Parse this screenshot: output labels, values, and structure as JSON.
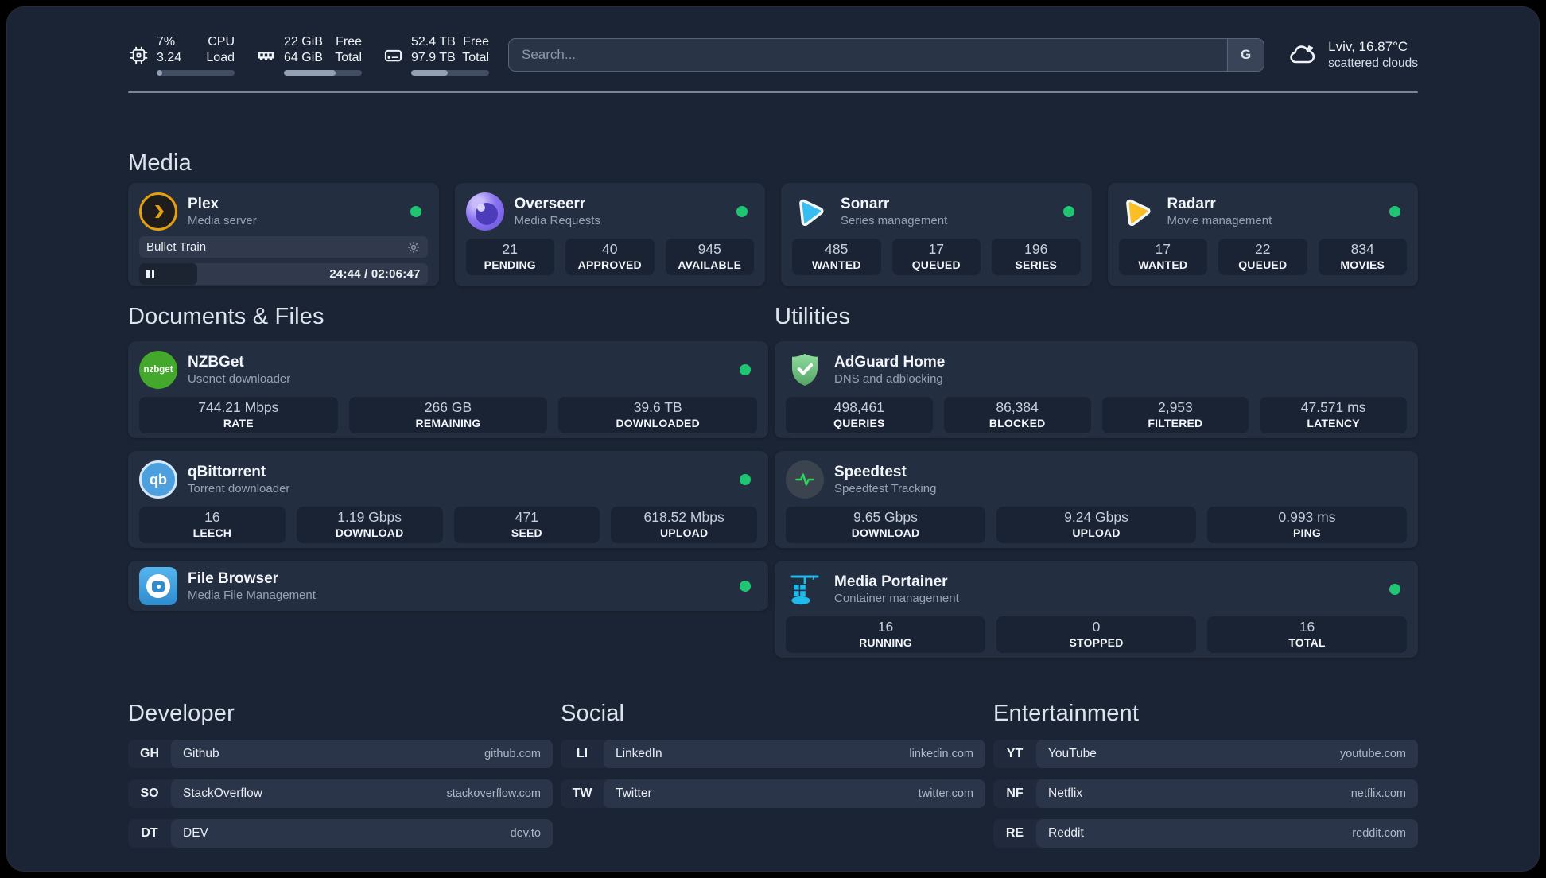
{
  "topbar": {
    "cpu": {
      "value1": "7%",
      "value2": "3.24",
      "label1": "CPU",
      "label2": "Load",
      "fill": 7
    },
    "memory": {
      "value1": "22 GiB",
      "value2": "64 GiB",
      "label1": "Free",
      "label2": "Total",
      "fill": 66
    },
    "disk": {
      "value1": "52.4 TB",
      "value2": "97.9 TB",
      "label1": "Free",
      "label2": "Total",
      "fill": 47
    },
    "search": {
      "placeholder": "Search...",
      "provider_label": "G"
    },
    "weather": {
      "title": "Lviv, 16.87°C",
      "subtitle": "scattered clouds"
    }
  },
  "sections": {
    "media": "Media",
    "documents": "Documents & Files",
    "utilities": "Utilities",
    "developer": "Developer",
    "social": "Social",
    "entertainment": "Entertainment"
  },
  "services": {
    "plex": {
      "name": "Plex",
      "desc": "Media server",
      "now_playing": {
        "title": "Bullet Train",
        "time": "24:44 / 02:06:47",
        "progress_pct": 20
      }
    },
    "overseerr": {
      "name": "Overseerr",
      "desc": "Media Requests",
      "stats": [
        {
          "value": "21",
          "label": "PENDING"
        },
        {
          "value": "40",
          "label": "APPROVED"
        },
        {
          "value": "945",
          "label": "AVAILABLE"
        }
      ]
    },
    "sonarr": {
      "name": "Sonarr",
      "desc": "Series management",
      "stats": [
        {
          "value": "485",
          "label": "WANTED"
        },
        {
          "value": "17",
          "label": "QUEUED"
        },
        {
          "value": "196",
          "label": "SERIES"
        }
      ]
    },
    "radarr": {
      "name": "Radarr",
      "desc": "Movie management",
      "stats": [
        {
          "value": "17",
          "label": "WANTED"
        },
        {
          "value": "22",
          "label": "QUEUED"
        },
        {
          "value": "834",
          "label": "MOVIES"
        }
      ]
    },
    "nzbget": {
      "name": "NZBGet",
      "desc": "Usenet downloader",
      "icon_text": "nzbget",
      "stats": [
        {
          "value": "744.21 Mbps",
          "label": "RATE"
        },
        {
          "value": "266 GB",
          "label": "REMAINING"
        },
        {
          "value": "39.6 TB",
          "label": "DOWNLOADED"
        }
      ]
    },
    "qbittorrent": {
      "name": "qBittorrent",
      "desc": "Torrent downloader",
      "icon_text": "qb",
      "stats": [
        {
          "value": "16",
          "label": "LEECH"
        },
        {
          "value": "1.19 Gbps",
          "label": "DOWNLOAD"
        },
        {
          "value": "471",
          "label": "SEED"
        },
        {
          "value": "618.52 Mbps",
          "label": "UPLOAD"
        }
      ]
    },
    "filebrowser": {
      "name": "File Browser",
      "desc": "Media File Management"
    },
    "adguard": {
      "name": "AdGuard Home",
      "desc": "DNS and adblocking",
      "stats": [
        {
          "value": "498,461",
          "label": "QUERIES"
        },
        {
          "value": "86,384",
          "label": "BLOCKED"
        },
        {
          "value": "2,953",
          "label": "FILTERED"
        },
        {
          "value": "47.571 ms",
          "label": "LATENCY"
        }
      ]
    },
    "speedtest": {
      "name": "Speedtest",
      "desc": "Speedtest Tracking",
      "stats": [
        {
          "value": "9.65 Gbps",
          "label": "DOWNLOAD"
        },
        {
          "value": "9.24 Gbps",
          "label": "UPLOAD"
        },
        {
          "value": "0.993 ms",
          "label": "PING"
        }
      ]
    },
    "portainer": {
      "name": "Media Portainer",
      "desc": "Container management",
      "stats": [
        {
          "value": "16",
          "label": "RUNNING"
        },
        {
          "value": "0",
          "label": "STOPPED"
        },
        {
          "value": "16",
          "label": "TOTAL"
        }
      ]
    }
  },
  "bookmarks": {
    "developer": [
      {
        "abbr": "GH",
        "name": "Github",
        "url": "github.com"
      },
      {
        "abbr": "SO",
        "name": "StackOverflow",
        "url": "stackoverflow.com"
      },
      {
        "abbr": "DT",
        "name": "DEV",
        "url": "dev.to"
      }
    ],
    "social": [
      {
        "abbr": "LI",
        "name": "LinkedIn",
        "url": "linkedin.com"
      },
      {
        "abbr": "TW",
        "name": "Twitter",
        "url": "twitter.com"
      }
    ],
    "entertainment": [
      {
        "abbr": "YT",
        "name": "YouTube",
        "url": "youtube.com"
      },
      {
        "abbr": "NF",
        "name": "Netflix",
        "url": "netflix.com"
      },
      {
        "abbr": "RE",
        "name": "Reddit",
        "url": "reddit.com"
      }
    ]
  },
  "colors": {
    "status_online": "#20c573",
    "plex_amber": "#e5a00d",
    "sonarr_blue": "#38bdf2",
    "radarr_yellow": "#fbbf24",
    "nzbget_green": "#44a82c",
    "qbittorrent_blue": "#4d9fdd",
    "adguard_green": "#6cc07a",
    "speedtest_pulse": "#2fd05e",
    "filebrowser_blue": "#3ea2dd",
    "portainer_blue": "#1fb9ec",
    "overseerr_purple": "#8b74f0"
  }
}
